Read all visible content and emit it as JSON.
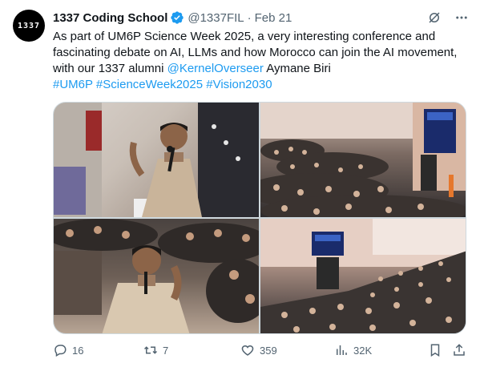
{
  "author": {
    "avatar_text": "1337",
    "name": "1337 Coding School",
    "handle": "@1337FIL",
    "separator": "·",
    "date": "Feb 21"
  },
  "post": {
    "text_1": "As part of UM6P Science Week 2025, a very interesting conference and fascinating debate on AI, LLMs and how Morocco can join the AI movement, with our 1337 alumni ",
    "mention": "@KernelOverseer",
    "text_2": " Aymane Biri",
    "hashtags": [
      "#UM6P",
      "#ScienceWeek2025",
      "#Vision2030"
    ]
  },
  "media": {
    "photos": [
      "speaker-with-microphone-photo",
      "auditorium-audience-photo",
      "speaker-gesturing-photo",
      "lecture-hall-wide-photo"
    ]
  },
  "metrics": {
    "replies": "16",
    "reposts": "7",
    "likes": "359",
    "views": "32K"
  },
  "colors": {
    "link": "#1d9bf0",
    "verified": "#1d9bf0",
    "secondary_text": "#536471"
  }
}
